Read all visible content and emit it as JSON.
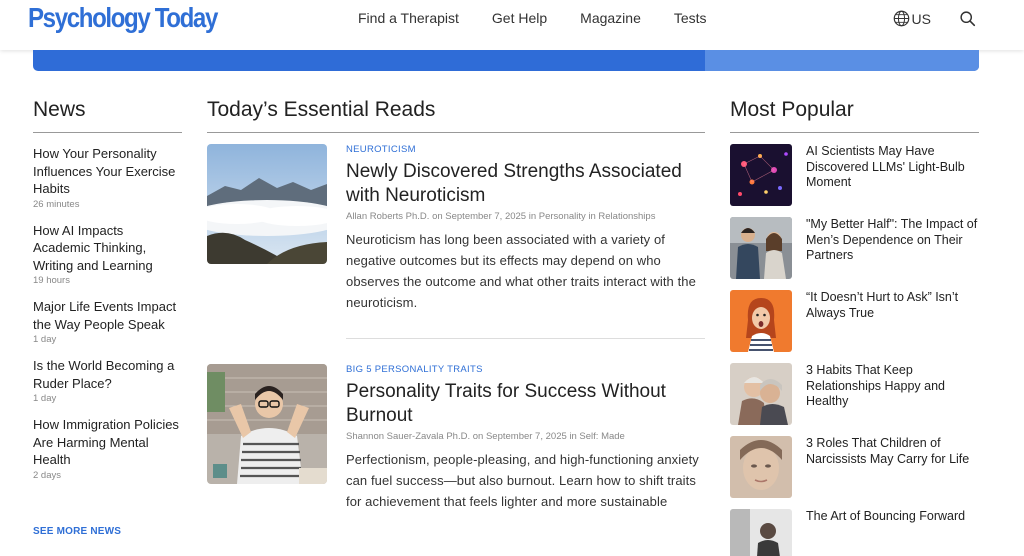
{
  "header": {
    "logo": "Psychology Today",
    "nav": [
      "Find a Therapist",
      "Get Help",
      "Magazine",
      "Tests"
    ],
    "region": "US"
  },
  "news": {
    "title": "News",
    "items": [
      {
        "title": "How Your Personality Influences Your Exercise Habits",
        "ago": "26 minutes"
      },
      {
        "title": "How AI Impacts Academic Thinking, Writing and Learning",
        "ago": "19 hours"
      },
      {
        "title": "Major Life Events Impact the Way People Speak",
        "ago": "1 day"
      },
      {
        "title": "Is the World Becoming a Ruder Place?",
        "ago": "1 day"
      },
      {
        "title": "How Immigration Policies Are Harming Mental Health",
        "ago": "2 days"
      }
    ],
    "see_more": "SEE MORE NEWS"
  },
  "reads": {
    "title": "Today’s Essential Reads",
    "articles": [
      {
        "category": "NEUROTICISM",
        "title": "Newly Discovered Strengths Associated with Neuroticism",
        "meta": "Allan Roberts Ph.D. on September 7, 2025 in Personality in Relationships",
        "desc": "Neuroticism has long been associated with a variety of negative outcomes but its effects may depend on who observes the outcome and what other traits interact with the neuroticism."
      },
      {
        "category": "BIG 5 PERSONALITY TRAITS",
        "title": "Personality Traits for Success Without Burnout",
        "meta": "Shannon Sauer-Zavala Ph.D. on September 7, 2025 in Self: Made",
        "desc": "Perfectionism, people-pleasing, and high-functioning anxiety can fuel success—but also burnout. Learn how to shift traits for achievement that feels lighter and more sustainable"
      }
    ]
  },
  "popular": {
    "title": "Most Popular",
    "items": [
      {
        "title": "AI Scientists May Have Discovered LLMs' Light-Bulb Moment"
      },
      {
        "title": "\"My Better Half\": The Impact of Men’s Dependence on Their Partners"
      },
      {
        "title": "“It Doesn’t Hurt to Ask” Isn’t Always True"
      },
      {
        "title": "3 Habits That Keep Relationships Happy and Healthy"
      },
      {
        "title": "3 Roles That Children of Narcissists May Carry for Life"
      },
      {
        "title": "The Art of Bouncing Forward"
      }
    ]
  },
  "colors": {
    "accent": "#2f6fd6",
    "banner": "#2f6cd7"
  }
}
